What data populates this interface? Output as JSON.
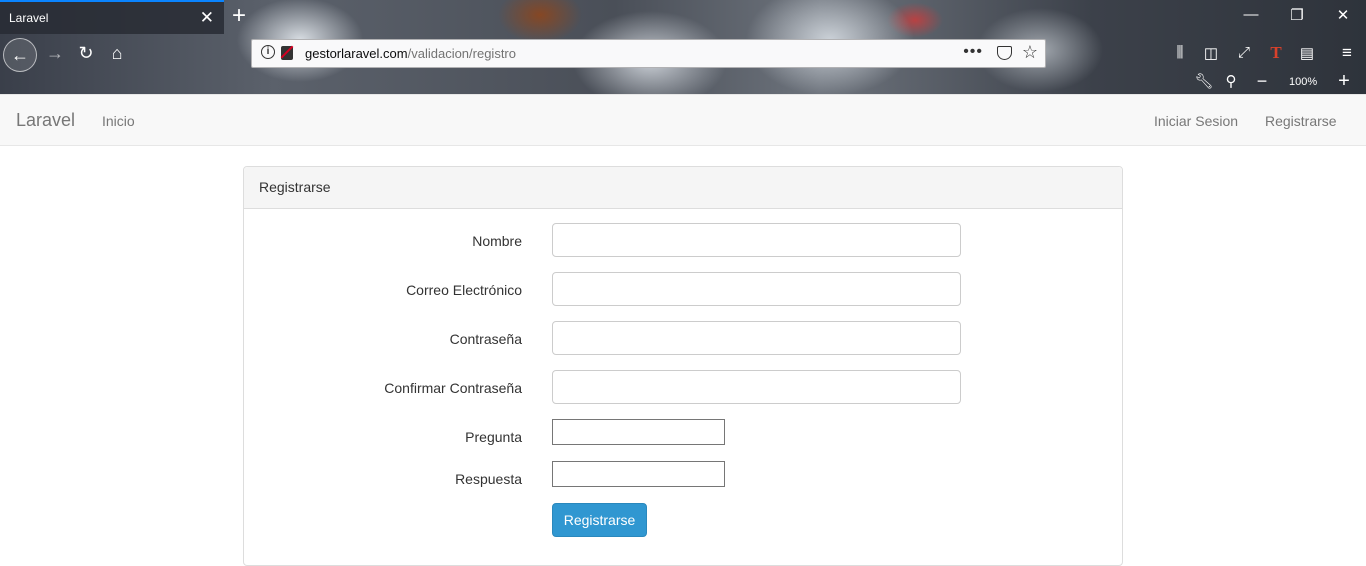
{
  "browser": {
    "tab_title": "Laravel",
    "tab_close": "✕",
    "new_tab": "+",
    "url_host": "gestorlaravel.com",
    "url_path": "/validacion/registro",
    "page_actions": "•••",
    "zoom_level": "100%",
    "icons": [
      "back-icon",
      "forward-icon",
      "reload-icon",
      "home-icon",
      "info-icon",
      "insecure-lock-icon",
      "pocket-icon",
      "star-icon",
      "library-icon",
      "sidebar-icon",
      "fullscreen-icon",
      "extension-icon",
      "reader-icon",
      "menu-icon",
      "wrench-icon",
      "zoom-icon"
    ]
  },
  "navbar": {
    "brand": "Laravel",
    "home": "Inicio",
    "login": "Iniciar Sesion",
    "register": "Registrarse"
  },
  "panel": {
    "heading": "Registrarse",
    "fields": {
      "name_label": "Nombre",
      "email_label": "Correo Electrónico",
      "password_label": "Contraseña",
      "confirm_label": "Confirmar Contraseña",
      "question_label": "Pregunta",
      "answer_label": "Respuesta"
    },
    "values": {
      "name": "",
      "email": "",
      "password": "",
      "confirm": "",
      "question": "",
      "answer": ""
    },
    "submit": "Registrarse"
  }
}
